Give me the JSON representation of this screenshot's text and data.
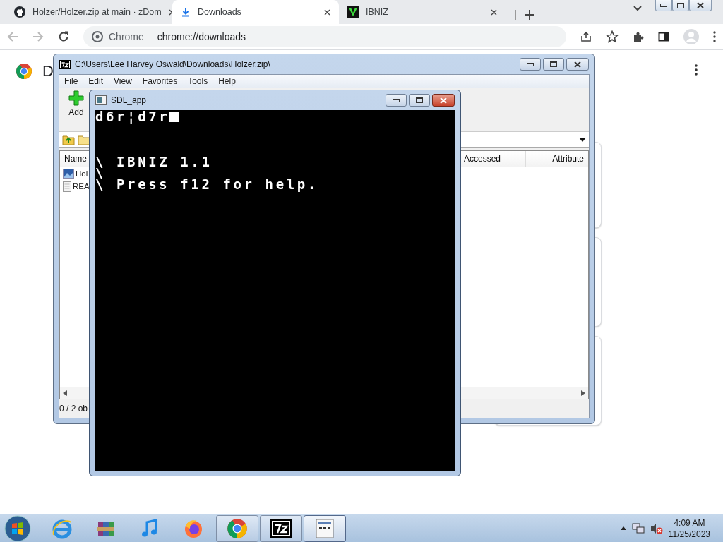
{
  "browser": {
    "tabs": [
      {
        "title": "Holzer/Holzer.zip at main · zDom",
        "kind": "github",
        "selected": false
      },
      {
        "title": "Downloads",
        "kind": "download",
        "selected": true
      },
      {
        "title": "IBNIZ",
        "kind": "ibniz",
        "selected": false
      }
    ],
    "address": {
      "site_label": "Chrome",
      "url": "chrome://downloads"
    },
    "page": {
      "heading": "D"
    }
  },
  "archive_window": {
    "title": "C:\\Users\\Lee Harvey Oswald\\Downloads\\Holzer.zip\\",
    "menu": [
      "File",
      "Edit",
      "View",
      "Favorites",
      "Tools",
      "Help"
    ],
    "toolbar": [
      "Add"
    ],
    "columns": [
      "Name",
      "Accessed",
      "Attribute"
    ],
    "rows": [
      {
        "name": "Hol",
        "kind": "image"
      },
      {
        "name": "REA",
        "kind": "text"
      }
    ],
    "status": "0 / 2 ob"
  },
  "console_window": {
    "title": "SDL_app",
    "input": "d6r¦d7r",
    "lines": [
      "\\ IBNIZ 1.1",
      "\\",
      "\\ Press f12 for help."
    ]
  },
  "taskbar": {
    "apps": [
      {
        "kind": "ie",
        "running": false,
        "selected": false
      },
      {
        "kind": "archiver",
        "running": false,
        "selected": false
      },
      {
        "kind": "music",
        "running": false,
        "selected": false
      },
      {
        "kind": "firefox",
        "running": false,
        "selected": false
      },
      {
        "kind": "chrome",
        "running": true,
        "selected": false
      },
      {
        "kind": "sevenzip",
        "running": true,
        "selected": false
      },
      {
        "kind": "sdl",
        "running": true,
        "selected": true
      }
    ],
    "time": "4:09 AM",
    "date": "11/25/2023"
  }
}
